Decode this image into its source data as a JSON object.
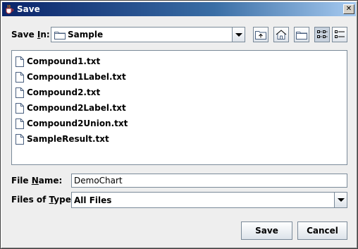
{
  "window": {
    "title": "Save",
    "close_glyph": "✕"
  },
  "save_in": {
    "label_prefix": "Save ",
    "label_mnemonic": "I",
    "label_suffix": "n:",
    "folder": "Sample"
  },
  "toolbar": {
    "buttons": [
      {
        "icon": "up-one-level-icon"
      },
      {
        "icon": "home-icon"
      },
      {
        "icon": "new-folder-icon"
      },
      {
        "icon": "list-view-icon",
        "pressed": true
      },
      {
        "icon": "details-view-icon"
      }
    ]
  },
  "files": [
    "Compound1.txt",
    "Compound1Label.txt",
    "Compound2.txt",
    "Compound2Label.txt",
    "Compound2Union.txt",
    "SampleResult.txt"
  ],
  "file_name": {
    "label_prefix": "File ",
    "label_mnemonic": "N",
    "label_suffix": "ame:",
    "value": "DemoChart"
  },
  "files_of_type": {
    "label_prefix": "Files of ",
    "label_mnemonic": "T",
    "label_suffix": "ype:",
    "selected": "All Files"
  },
  "actions": {
    "save_label": "Save",
    "cancel_label": "Cancel"
  }
}
